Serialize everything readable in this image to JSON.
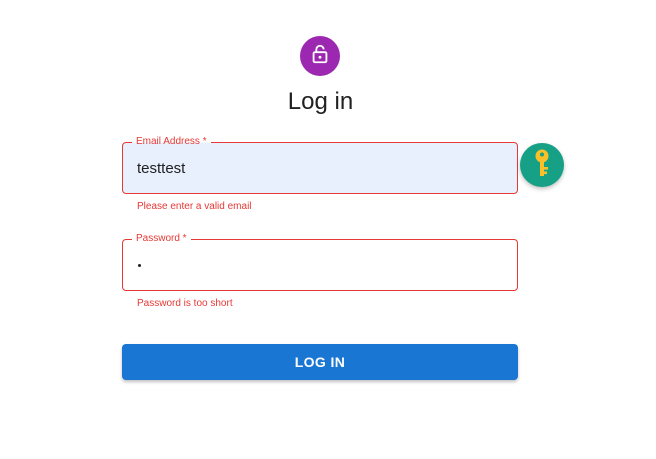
{
  "header": {
    "avatar_icon": "lock-open-icon",
    "avatar_color": "#9c27b0",
    "title": "Log in"
  },
  "form": {
    "email": {
      "label": "Email Address *",
      "value": "testtest",
      "error": "Please enter a valid email",
      "autofill_icon": "key-icon"
    },
    "password": {
      "label": "Password *",
      "error": "Password is too short"
    },
    "submit_label": "LOG IN"
  },
  "colors": {
    "error": "#e53935",
    "primary": "#1976d2",
    "autofill_bg": "#e8f0fe",
    "key_badge": "#16a085",
    "key_icon": "#f9c02a"
  }
}
